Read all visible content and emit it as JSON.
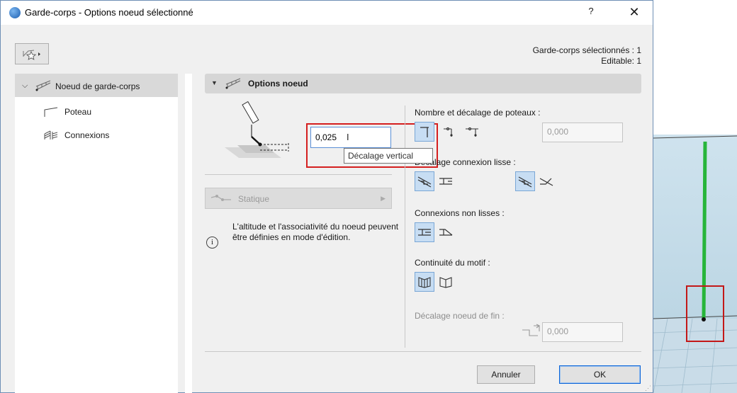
{
  "window": {
    "title": "Garde-corps - Options noeud sélectionné",
    "help_label": "?",
    "close_label": "✕"
  },
  "summary": {
    "line1": "Garde-corps sélectionnés : 1",
    "line2": "Editable: 1"
  },
  "tree": {
    "header": {
      "chevron": "❯",
      "label": "Noeud de garde-corps",
      "icon": "railing-node-icon"
    },
    "items": [
      {
        "label": "Poteau",
        "icon": "post-icon"
      },
      {
        "label": "Connexions",
        "icon": "connections-icon"
      }
    ]
  },
  "panel": {
    "title": "Options noeud",
    "vertical_offset_value": "0,025",
    "tooltip": "Décalage vertical",
    "static_label": "Statique",
    "info_text": "L'altitude et l'associativité du noeud peuvent être définies en mode d'édition.",
    "info_icon": "i",
    "sections": {
      "posts": {
        "label": "Nombre et décalage de poteaux :",
        "value": "0,000"
      },
      "smooth": {
        "label": "Décalage connexion lisse :"
      },
      "non_smooth": {
        "label": "Connexions non lisses :"
      },
      "pattern": {
        "label": "Continuité du motif :"
      },
      "end_offset": {
        "label": "Décalage noeud de fin :",
        "value": "0,000"
      }
    },
    "buttons": {
      "cancel": "Annuler",
      "ok": "OK"
    }
  },
  "colors": {
    "accent": "#0a64d8",
    "highlight": "#d51f1f",
    "selected_bg": "#c7ddf3",
    "post_green": "#27b53a"
  }
}
